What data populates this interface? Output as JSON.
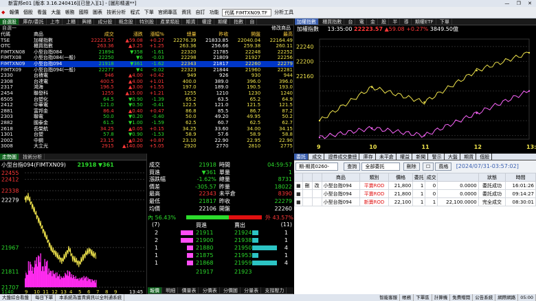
{
  "window": {
    "title": "新富邦e01 [版本 3.16.240416][已登入][1] - [圖形精選**]",
    "controls": "— ❐ ✕"
  },
  "menubar": {
    "items": [
      "報價",
      "個股",
      "看盤",
      "大盤",
      "帳務",
      "國際",
      "圖表",
      "技術分析",
      "程式",
      "下單",
      "官網專區",
      "資訊",
      "自訂",
      "功能"
    ],
    "code_value": "代碼 FIMTXN09.TF",
    "analysis_tool": "分析工具"
  },
  "quote_panel": {
    "tabs": [
      "自選股",
      "庫存/委託",
      "上市",
      "上櫃",
      "興櫃",
      "成分股",
      "概念股",
      "特別股",
      "產業類股",
      "期貨",
      "權證",
      "期權",
      "指數",
      "自"
    ],
    "group_label": "自選一",
    "edit_label": "修改商品",
    "headers": [
      "代碼",
      "商品",
      "成交",
      "漲跌",
      "漲幅%",
      "總量",
      "昨收",
      "開盤",
      "最高",
      "最低",
      "單量",
      "最近",
      "昨收"
    ],
    "rows": [
      [
        "TSE",
        "加權指數",
        "22223.57",
        "▲59.08",
        "+0.27",
        "22276.39",
        "21833.85",
        "22040.04",
        "22164.49"
      ],
      [
        "OTC",
        "櫃買指數",
        "263.36",
        "▲3.25",
        "+1.25",
        "263.36",
        "256.66",
        "259.38",
        "260.11"
      ],
      [
        "FIMTXN08",
        "小型台指084",
        "21894",
        "▼358",
        "-1.61",
        "22320",
        "21785",
        "22248",
        "22252"
      ],
      [
        "FIMTX08",
        "小型台指084(一般)",
        "22250",
        "▼6",
        "-0.03",
        "22298",
        "21809",
        "21927",
        "22256"
      ],
      [
        "FIMTXN09",
        "小型台指094",
        "21918",
        "▼361",
        "-1.62",
        "22343",
        "21817",
        "22260",
        "22279"
      ],
      [
        "FIMTX09",
        "小型台指094(一般)",
        "22277",
        "▼4",
        "-0.02",
        "22323",
        "21844",
        "21960",
        "22281"
      ],
      [
        "2330",
        "台積電",
        "946",
        "▲4.00",
        "+0.42",
        "949",
        "926",
        "930",
        "944"
      ],
      [
        "2308",
        "台達電",
        "400.5",
        "▲4.00",
        "+1.01",
        "400.0",
        "389.0",
        "396.0",
        "396.0"
      ],
      [
        "2317",
        "鴻海",
        "196.5",
        "▲3.00",
        "+1.55",
        "197.0",
        "189.0",
        "190.5",
        "193.0"
      ],
      [
        "2454",
        "聯發科",
        "1255",
        "▲15.00",
        "+1.21",
        "1255",
        "1210",
        "1230",
        "1240"
      ],
      [
        "6505",
        "台塑化",
        "64.5",
        "▼0.90",
        "-1.39",
        "65.2",
        "63.5",
        "65.2",
        "64.9"
      ],
      [
        "2412",
        "中華電",
        "121.0",
        "▼0.50",
        "-0.41",
        "122.5",
        "121.0",
        "121.5",
        "121.5"
      ],
      [
        "2881",
        "富邦金",
        "86.4",
        "▲0.40",
        "+0.47",
        "86.8",
        "85.5",
        "86.7",
        "87.2"
      ],
      [
        "2303",
        "聯電",
        "50.0",
        "▼0.20",
        "-0.40",
        "50.0",
        "49.20",
        "49.95",
        "50.2"
      ],
      [
        "2882",
        "國泰金",
        "61.5",
        "▼1.00",
        "-1.59",
        "62.5",
        "60.7",
        "62.5",
        "62.7"
      ],
      [
        "2618",
        "長榮航",
        "34.25",
        "▲0.05",
        "+0.15",
        "34.25",
        "33.60",
        "34.00",
        "34.15"
      ],
      [
        "1301",
        "台塑",
        "57.8",
        "▼0.90",
        "-1.53",
        "58.9",
        "57.6",
        "58.9",
        "58.8"
      ],
      [
        "2002",
        "中鋼",
        "23.15",
        "▲0.20",
        "+0.87",
        "23.10",
        "22.90",
        "22.95",
        "22.90"
      ],
      [
        "3008",
        "大立光",
        "2915",
        "▲140.00",
        "+5.05",
        "2920",
        "2770",
        "2810",
        "2775"
      ]
    ]
  },
  "index_chart": {
    "tabs": [
      "加權指數",
      "櫃買指數",
      "台",
      "電",
      "金",
      "股",
      "半",
      "導",
      "期權ETF",
      "下單"
    ],
    "name": "加權指數",
    "time": "13:35:00",
    "price": "22223.57",
    "change": "▲59.08",
    "pct": "+0.27%",
    "volume": "3849.50億",
    "y_ticks": [
      "22240",
      "22200",
      "22160"
    ],
    "x_ticks": [
      "9",
      "10",
      "11",
      "12",
      "13:30"
    ]
  },
  "chart_data": {
    "type": "line",
    "x": [
      "9",
      "10",
      "11",
      "12",
      "13:30"
    ],
    "series": [
      {
        "name": "加權指數",
        "values": [
          22040,
          22130,
          22090,
          22175,
          22223
        ]
      },
      {
        "name": "櫃買",
        "values": [
          21995,
          22020,
          22000,
          22060,
          22120
        ]
      }
    ],
    "ylim": [
      21990,
      22260
    ],
    "grid": true
  },
  "futures_panel": {
    "tabs": [
      "走勢圖",
      "技術分析"
    ],
    "title": "小型台指094(FIMTXN09)",
    "price": "21918",
    "change": "▼361",
    "y_ticks": [
      "22455",
      "22412",
      "22338",
      "22279",
      "21967",
      "21811",
      "21707"
    ],
    "x_ticks": [
      "9",
      "10",
      "11",
      "12",
      "13",
      "4",
      "5",
      "6",
      "7",
      "8",
      "9"
    ],
    "time_end": "13:45",
    "label_vol": "1140"
  },
  "detail_panel": {
    "rows": [
      [
        "成交",
        "21918",
        "時間",
        "04:59:57"
      ],
      [
        "買進",
        "▼361",
        "單量",
        "1"
      ],
      [
        "漲跌幅",
        "-1.62%",
        "總量",
        "8731"
      ],
      [
        "價差",
        "-305.57",
        "昨量",
        "18022"
      ],
      [
        "最高",
        "22343",
        "未平倉",
        "8390"
      ],
      [
        "最低",
        "21817",
        "昨收",
        "22279"
      ],
      [
        "均價",
        "22106",
        "開盤",
        "22260"
      ]
    ],
    "inner_label": "內 56.43%",
    "outer_label": "外 43.57%",
    "inner_pct": 56.43,
    "count_left": "(7)",
    "count_right": "(11)",
    "bid_header": "買進",
    "ask_header": "賣出",
    "book": [
      {
        "bq": "2",
        "bid": "21911",
        "ask": "21924",
        "aq": "1"
      },
      {
        "bq": "2",
        "bid": "21900",
        "ask": "21938",
        "aq": "1"
      },
      {
        "bq": "1",
        "bid": "21880",
        "ask": "21950",
        "aq": "4"
      },
      {
        "bq": "1",
        "bid": "21875",
        "ask": "21953",
        "aq": "1"
      },
      {
        "bq": "1",
        "bid": "21868",
        "ask": "21959",
        "aq": "4"
      }
    ],
    "book_bid_bars": [
      0.5,
      0.5,
      0.25,
      0.25,
      0.25
    ],
    "book_ask_bars": [
      0.25,
      0.25,
      1.0,
      0.25,
      1.0
    ],
    "total_bid": "21917",
    "total_ask": "21923",
    "bottom_tabs": [
      "報價",
      "明細",
      "價量表",
      "分價表",
      "分價圖",
      "分量表",
      "支撐壓力"
    ]
  },
  "order_panel": {
    "tabs": [
      "委託",
      "成交",
      "證券成交彙總",
      "庫存",
      "未平倉",
      "權益",
      "新聞",
      "警示",
      "大盤",
      "期貨",
      "個股"
    ],
    "account": "期-期貨0260-",
    "query_label": "查詢",
    "filter": "全部委託",
    "delete_label": "刪除",
    "style_label": "風格",
    "timestamp": "[2024/07/31-03:57:02]",
    "headers": [
      "",
      "",
      "",
      "商品",
      "類別",
      "價格",
      "委託",
      "成交",
      "",
      "狀態",
      "時間"
    ],
    "rows": [
      {
        "action1": "刪",
        "action2": "改",
        "product": "小型台指094",
        "type": "平賣ROD",
        "price": "21,800",
        "qty": "1",
        "filled": "0",
        "amount": "0.0000",
        "status": "委託成功",
        "time": "16:01:26"
      },
      {
        "action1": "",
        "action2": "",
        "product": "小型台指094",
        "type": "平賣ROD",
        "price": "21,800",
        "qty": "1",
        "filled": "0",
        "amount": "0.0000",
        "status": "委託成功",
        "time": "09:14:27"
      },
      {
        "action1": "",
        "action2": "",
        "product": "小型台指094",
        "type": "新賣ROD",
        "price": "22,100",
        "qty": "1",
        "filled": "1",
        "amount": "22,100.0000",
        "status": "完全成交",
        "time": "08:30:01"
      }
    ]
  },
  "statusbar": {
    "items": [
      "大盤綜合看盤",
      "每日下單",
      "本系統為富貴資訊以全利通系統"
    ],
    "right_items": [
      "智能客服",
      "帳務",
      "下單區",
      "計算機",
      "免費贈閱",
      "公告系統",
      "網際網路",
      "05:00"
    ]
  },
  "colors": {
    "up": "#ff3838",
    "down": "#2cdc2c",
    "flat": "#f0e44c",
    "accent": "#3a5fb0"
  }
}
